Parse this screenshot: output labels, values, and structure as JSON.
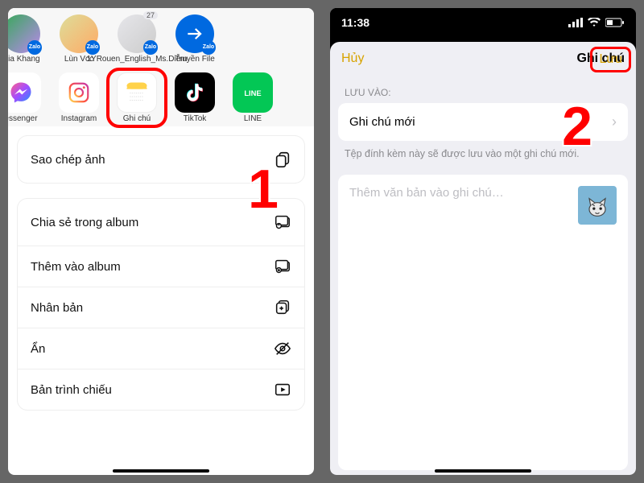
{
  "left": {
    "contacts": [
      {
        "name": "Gia Khang"
      },
      {
        "name": "Lùn Vcc"
      },
      {
        "name": "1YRouen_English_Ms.Diễm",
        "count": "27"
      },
      {
        "name": "Truyền File"
      }
    ],
    "apps": [
      {
        "name": "essenger"
      },
      {
        "name": "Instagram"
      },
      {
        "name": "Ghi chú"
      },
      {
        "name": "TikTok"
      },
      {
        "name": "LINE"
      }
    ],
    "actions": [
      {
        "label": "Sao chép ảnh"
      },
      {
        "label": "Chia sẻ trong album"
      },
      {
        "label": "Thêm vào album"
      },
      {
        "label": "Nhân bản"
      },
      {
        "label": "Ẩn"
      },
      {
        "label": "Bản trình chiếu"
      }
    ],
    "anno": "1"
  },
  "right": {
    "time": "11:38",
    "cancel": "Hủy",
    "title": "Ghi chú",
    "save": "Lưu",
    "section_label": "LƯU VÀO:",
    "folder": "Ghi chú mới",
    "helper": "Tệp đính kèm này sẽ được lưu vào một ghi chú mới.",
    "placeholder": "Thêm văn bản vào ghi chú…",
    "anno": "2"
  }
}
